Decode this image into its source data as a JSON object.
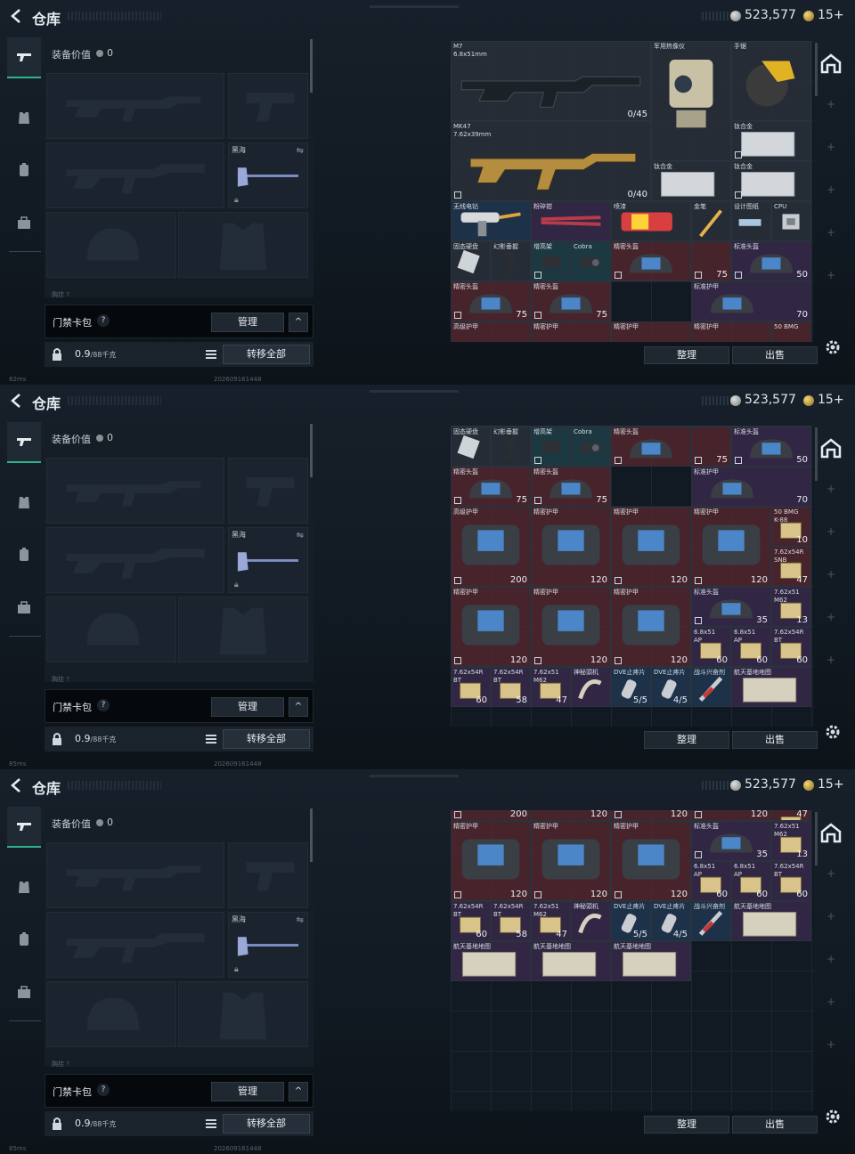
{
  "header": {
    "title": "仓库",
    "silver": "523,577",
    "gold": "15+"
  },
  "equipment": {
    "label": "装备价值",
    "value": "0",
    "secure_slot_label": "黑海",
    "tiny_label": "胸挂  ?"
  },
  "card_bag": {
    "name": "门禁卡包",
    "help": "?",
    "manage": "管理",
    "collapse": "^"
  },
  "bottom": {
    "weight": "0.9",
    "weight_unit": "/88千克",
    "transfer": "转移全部"
  },
  "actions": {
    "sort": "整理",
    "sell": "出售"
  },
  "status": [
    {
      "ping": "82ms",
      "id": "202609161448"
    },
    {
      "ping": "85ms",
      "id": "202609161448"
    },
    {
      "ping": "85ms",
      "id": "202609161448"
    }
  ],
  "icons": {
    "back": "back-arrow-icon",
    "weapon_tab": "gun-icon",
    "armor_tab": "armor-icon",
    "bag_tab": "backpack-icon",
    "case_tab": "briefcase-icon",
    "home": "home-icon",
    "gear": "gear-icon",
    "lock": "lock-icon",
    "list": "list-icon"
  },
  "colors": {
    "accent": "#2fb38a",
    "red_cell": "#5a2830",
    "purple_cell": "#3a2a4e",
    "blue_cell": "#203650"
  },
  "panels": [
    {
      "cells": [
        {
          "name": "M7\n6.8x51mm",
          "num": "0/45",
          "color": "dark",
          "art": "rifle",
          "tag": false
        },
        {
          "name": "军用热像仪",
          "num": "",
          "color": "dark",
          "art": "camera",
          "tag": false
        },
        {
          "name": "手锯",
          "num": "",
          "color": "dark",
          "art": "saw",
          "tag": false
        },
        {
          "name": "MK47\n7.62x39mm",
          "num": "0/40",
          "color": "dark",
          "art": "rifle2",
          "tag": true
        },
        {
          "name": "钛合金",
          "num": "",
          "color": "dark",
          "art": "plate",
          "tag": true
        },
        {
          "name": "钛合金",
          "num": "",
          "color": "dark",
          "art": "plate",
          "tag": false
        },
        {
          "name": "钛合金",
          "num": "",
          "color": "dark",
          "art": "plate",
          "tag": true
        },
        {
          "name": "无线电钻",
          "num": "",
          "color": "blue",
          "art": "drill",
          "tag": false
        },
        {
          "name": "粉碎钳",
          "num": "",
          "color": "purple",
          "art": "pliers",
          "tag": false
        },
        {
          "name": "喷漆",
          "num": "",
          "color": "dark",
          "art": "spray",
          "tag": false
        },
        {
          "name": "金笔",
          "num": "",
          "color": "dark",
          "art": "pen",
          "tag": false
        },
        {
          "name": "设计图纸",
          "num": "",
          "color": "dark",
          "art": "syringe",
          "tag": false
        },
        {
          "name": "CPU",
          "num": "",
          "color": "dark",
          "art": "chip",
          "tag": false
        },
        {
          "name": "固态硬盘",
          "num": "",
          "color": "dark",
          "art": "ssd",
          "tag": false
        },
        {
          "name": "幻影垂握",
          "num": "",
          "color": "dark",
          "art": "grip",
          "tag": false
        },
        {
          "name": "增高架",
          "num": "",
          "color": "teal",
          "art": "mount",
          "tag": true
        },
        {
          "name": "Cobra",
          "num": "",
          "color": "teal",
          "art": "sight",
          "tag": false
        },
        {
          "name": "精密头盔",
          "num": "",
          "color": "red",
          "art": "helmet",
          "tag": true
        },
        {
          "name": "",
          "num": "75",
          "color": "red",
          "art": "none",
          "tag": true
        },
        {
          "name": "标准头盔",
          "num": "50",
          "color": "purple",
          "art": "helmet",
          "tag": true
        },
        {
          "name": "精密头盔",
          "num": "75",
          "color": "red",
          "art": "helmet",
          "tag": true
        },
        {
          "name": "精密头盔",
          "num": "75",
          "color": "red",
          "art": "helmet",
          "tag": true
        },
        {
          "name": "标准护甲",
          "num": "70",
          "color": "purple",
          "art": "helmet",
          "tag": false
        },
        {
          "name": "高级护甲",
          "num": "",
          "color": "red",
          "art": "none",
          "tag": false
        },
        {
          "name": "精密护甲",
          "num": "",
          "color": "red",
          "art": "none",
          "tag": false
        },
        {
          "name": "精密护甲",
          "num": "",
          "color": "red",
          "art": "none",
          "tag": false
        },
        {
          "name": "精密护甲",
          "num": "",
          "color": "red",
          "art": "none",
          "tag": false
        },
        {
          "name": "50 BMG",
          "num": "",
          "color": "red",
          "art": "none",
          "tag": false
        }
      ]
    },
    {
      "cells": [
        {
          "name": "",
          "num": "",
          "color": "blue",
          "art": "drill",
          "tag": false
        },
        {
          "name": "",
          "num": "",
          "color": "purple",
          "art": "pliers",
          "tag": false
        },
        {
          "name": "",
          "num": "",
          "color": "dark",
          "art": "spray",
          "tag": false
        },
        {
          "name": "",
          "num": "",
          "color": "dark",
          "art": "pen",
          "tag": false
        },
        {
          "name": "",
          "num": "",
          "color": "dark",
          "art": "syringe",
          "tag": false
        },
        {
          "name": "",
          "num": "",
          "color": "dark",
          "art": "chip",
          "tag": false
        },
        {
          "name": "固态硬盘",
          "num": "",
          "color": "dark",
          "art": "ssd",
          "tag": false
        },
        {
          "name": "幻影垂握",
          "num": "",
          "color": "dark",
          "art": "grip",
          "tag": false
        },
        {
          "name": "增高架",
          "num": "",
          "color": "teal",
          "art": "mount",
          "tag": true
        },
        {
          "name": "Cobra",
          "num": "",
          "color": "teal",
          "art": "sight",
          "tag": false
        },
        {
          "name": "精密头盔",
          "num": "",
          "color": "red",
          "art": "helmet",
          "tag": true
        },
        {
          "name": "",
          "num": "75",
          "color": "red",
          "art": "none",
          "tag": true
        },
        {
          "name": "标准头盔",
          "num": "50",
          "color": "purple",
          "art": "helmet",
          "tag": true
        },
        {
          "name": "精密头盔",
          "num": "75",
          "color": "red",
          "art": "helmet",
          "tag": true
        },
        {
          "name": "精密头盔",
          "num": "75",
          "color": "red",
          "art": "helmet",
          "tag": true
        },
        {
          "name": "标准护甲",
          "num": "70",
          "color": "purple",
          "art": "helmet",
          "tag": false
        },
        {
          "name": "高级护甲",
          "num": "200",
          "color": "red",
          "art": "armor",
          "tag": true
        },
        {
          "name": "精密护甲",
          "num": "120",
          "color": "red",
          "art": "armor",
          "tag": false
        },
        {
          "name": "精密护甲",
          "num": "120",
          "color": "red",
          "art": "armor",
          "tag": true
        },
        {
          "name": "精密护甲",
          "num": "120",
          "color": "red",
          "art": "armor",
          "tag": true
        },
        {
          "name": "50 BMG\nK-88",
          "num": "10",
          "color": "red",
          "art": "ammo",
          "tag": false
        },
        {
          "name": "7.62x54R\nSNB",
          "num": "47",
          "color": "red",
          "art": "ammo",
          "tag": false
        },
        {
          "name": "精密护甲",
          "num": "120",
          "color": "red",
          "art": "armor",
          "tag": true
        },
        {
          "name": "精密护甲",
          "num": "120",
          "color": "red",
          "art": "armor",
          "tag": true
        },
        {
          "name": "精密护甲",
          "num": "120",
          "color": "red",
          "art": "armor",
          "tag": true
        },
        {
          "name": "标准头盔",
          "num": "35",
          "color": "purple",
          "art": "helmet",
          "tag": true
        },
        {
          "name": "7.62x51\nM62",
          "num": "13",
          "color": "purple",
          "art": "ammo",
          "tag": false
        },
        {
          "name": "6.8x51\nAP",
          "num": "60",
          "color": "purple",
          "art": "ammo",
          "tag": false
        },
        {
          "name": "6.8x51\nAP",
          "num": "60",
          "color": "purple",
          "art": "ammo",
          "tag": false
        },
        {
          "name": "7.62x54R\nBT",
          "num": "60",
          "color": "purple",
          "art": "ammo",
          "tag": false
        },
        {
          "name": "7.62x54R\nBT",
          "num": "60",
          "color": "purple",
          "art": "ammo",
          "tag": false
        },
        {
          "name": "7.62x54R\nBT",
          "num": "58",
          "color": "purple",
          "art": "ammo",
          "tag": false
        },
        {
          "name": "7.62x51\nM62",
          "num": "47",
          "color": "purple",
          "art": "ammo",
          "tag": false
        },
        {
          "name": "神秘頭机",
          "num": "",
          "color": "purple",
          "art": "horn",
          "tag": false
        },
        {
          "name": "DVE止疼片",
          "num": "5/5",
          "color": "blue",
          "art": "pill",
          "tag": false
        },
        {
          "name": "DVE止疼片",
          "num": "4/5",
          "color": "blue",
          "art": "pill",
          "tag": false
        },
        {
          "name": "战斗兴奋剂",
          "num": "",
          "color": "blue",
          "art": "syringe2",
          "tag": false
        },
        {
          "name": "航天基地地图",
          "num": "",
          "color": "purple",
          "art": "map",
          "tag": false
        }
      ]
    },
    {
      "cells": [
        {
          "name": "",
          "num": "200",
          "color": "red",
          "art": "none",
          "tag": true
        },
        {
          "name": "",
          "num": "120",
          "color": "red",
          "art": "none",
          "tag": false
        },
        {
          "name": "",
          "num": "120",
          "color": "red",
          "art": "none",
          "tag": true
        },
        {
          "name": "",
          "num": "120",
          "color": "red",
          "art": "none",
          "tag": true
        },
        {
          "name": "",
          "num": "47",
          "color": "red",
          "art": "ammo",
          "tag": false
        },
        {
          "name": "精密护甲",
          "num": "120",
          "color": "red",
          "art": "armor",
          "tag": true
        },
        {
          "name": "精密护甲",
          "num": "120",
          "color": "red",
          "art": "armor",
          "tag": true
        },
        {
          "name": "精密护甲",
          "num": "120",
          "color": "red",
          "art": "armor",
          "tag": true
        },
        {
          "name": "标准头盔",
          "num": "35",
          "color": "purple",
          "art": "helmet",
          "tag": true
        },
        {
          "name": "7.62x51\nM62",
          "num": "13",
          "color": "purple",
          "art": "ammo",
          "tag": false
        },
        {
          "name": "6.8x51\nAP",
          "num": "60",
          "color": "purple",
          "art": "ammo",
          "tag": false
        },
        {
          "name": "6.8x51\nAP",
          "num": "60",
          "color": "purple",
          "art": "ammo",
          "tag": false
        },
        {
          "name": "7.62x54R\nBT",
          "num": "60",
          "color": "purple",
          "art": "ammo",
          "tag": false
        },
        {
          "name": "7.62x54R\nBT",
          "num": "60",
          "color": "purple",
          "art": "ammo",
          "tag": false
        },
        {
          "name": "7.62x54R\nBT",
          "num": "58",
          "color": "purple",
          "art": "ammo",
          "tag": false
        },
        {
          "name": "7.62x51\nM62",
          "num": "47",
          "color": "purple",
          "art": "ammo",
          "tag": false
        },
        {
          "name": "神秘頭机",
          "num": "",
          "color": "purple",
          "art": "horn",
          "tag": false
        },
        {
          "name": "DVE止疼片",
          "num": "5/5",
          "color": "blue",
          "art": "pill",
          "tag": false
        },
        {
          "name": "DVE止疼片",
          "num": "4/5",
          "color": "blue",
          "art": "pill",
          "tag": false
        },
        {
          "name": "战斗兴奋剂",
          "num": "",
          "color": "blue",
          "art": "syringe2",
          "tag": false
        },
        {
          "name": "航天基地地图",
          "num": "",
          "color": "purple",
          "art": "map",
          "tag": false
        },
        {
          "name": "航天基地地图",
          "num": "",
          "color": "purple",
          "art": "map",
          "tag": false
        },
        {
          "name": "航天基地地图",
          "num": "",
          "color": "purple",
          "art": "map",
          "tag": false
        },
        {
          "name": "航天基地地图",
          "num": "",
          "color": "purple",
          "art": "map",
          "tag": false
        }
      ]
    }
  ]
}
